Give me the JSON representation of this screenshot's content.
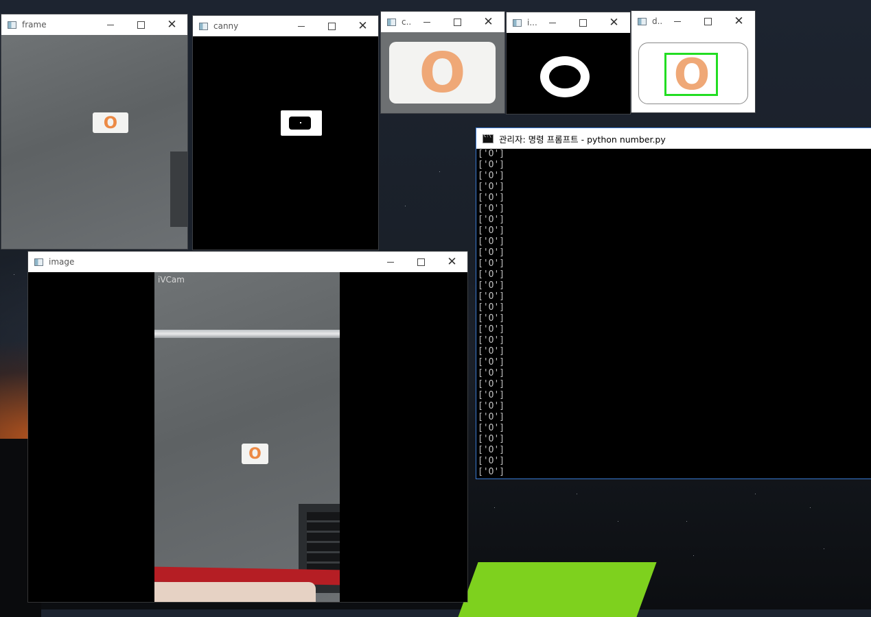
{
  "windows": {
    "frame": {
      "title": "frame"
    },
    "canny": {
      "title": "canny"
    },
    "crop": {
      "title": "c..."
    },
    "inverted": {
      "title": "i..."
    },
    "detect": {
      "title": "d..."
    },
    "image": {
      "title": "image",
      "overlay_text": "iVCam",
      "card_text": "O"
    },
    "frame_card_text": "O",
    "crop_card_text": "O",
    "detect_card_text": "O"
  },
  "console": {
    "title": "관리자: 명령 프롬프트 - python  number.py",
    "lines": [
      "['O']",
      "['O']",
      "['O']",
      "['O']",
      "['O']",
      "['O']",
      "['O']",
      "['O']",
      "['O']",
      "['O']",
      "['O']",
      "['O']",
      "['O']",
      "['O']",
      "['O']",
      "['O']",
      "['O']",
      "['O']",
      "['O']",
      "['O']",
      "['O']",
      "['O']",
      "['O']",
      "['O']",
      "['O']",
      "['O']",
      "['O']",
      "['O']",
      "['O']",
      "['O']"
    ]
  },
  "colors": {
    "card_orange": "#ec8a45",
    "detect_box": "#22dd22",
    "console_border": "#3a7bd5"
  }
}
